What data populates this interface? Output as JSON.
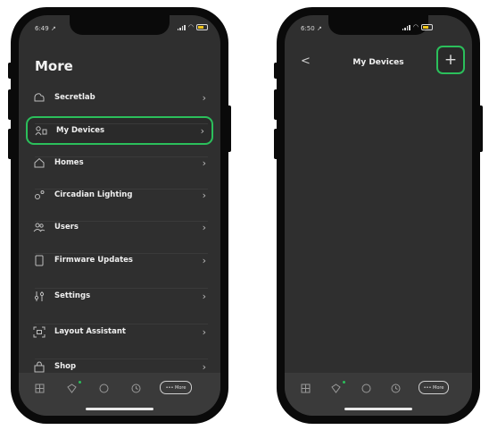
{
  "left": {
    "status_time": "6:49 ↗",
    "title": "More",
    "items": [
      {
        "label": "Secretlab",
        "icon": "cloud-icon"
      },
      {
        "label": "My Devices",
        "icon": "devices-icon",
        "highlighted": true
      },
      {
        "label": "Homes",
        "icon": "home-icon"
      },
      {
        "label": "Circadian Lighting",
        "icon": "circadian-icon"
      },
      {
        "label": "Users",
        "icon": "users-icon"
      },
      {
        "label": "Firmware Updates",
        "icon": "firmware-icon"
      },
      {
        "label": "Settings",
        "icon": "settings-icon"
      },
      {
        "label": "Layout Assistant",
        "icon": "layout-icon"
      },
      {
        "label": "Shop",
        "icon": "shop-icon"
      }
    ],
    "tabbar": {
      "more_label": "••• More"
    }
  },
  "right": {
    "status_time": "6:50 ↗",
    "title": "My Devices",
    "back_glyph": "<",
    "add_glyph": "+",
    "tabbar": {
      "more_label": "••• More"
    }
  },
  "colors": {
    "highlight": "#2bbf5b",
    "screen_bg": "#2f2f2f"
  }
}
